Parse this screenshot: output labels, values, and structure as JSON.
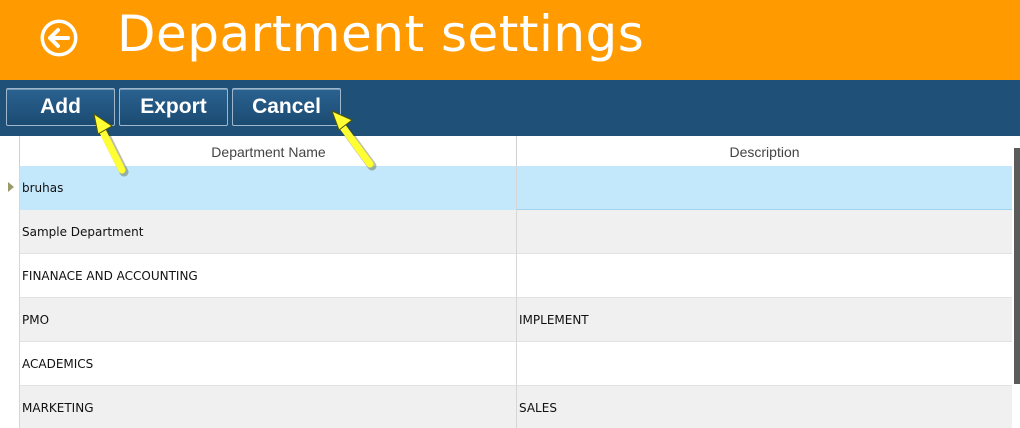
{
  "header": {
    "title": "Department settings",
    "back_icon": "back-arrow-circle-icon",
    "background_color": "#ff9a00"
  },
  "toolbar": {
    "add_label": "Add",
    "export_label": "Export",
    "cancel_label": "Cancel",
    "background_color": "#1f5077"
  },
  "grid": {
    "columns": [
      "Department Name",
      "Description"
    ],
    "rows": [
      {
        "name": "bruhas",
        "description": "",
        "selected": true
      },
      {
        "name": "Sample Department",
        "description": ""
      },
      {
        "name": "FINANACE AND ACCOUNTING",
        "description": ""
      },
      {
        "name": "PMO",
        "description": "IMPLEMENT"
      },
      {
        "name": "ACADEMICS",
        "description": ""
      },
      {
        "name": "MARKETING",
        "description": "SALES"
      }
    ],
    "selection_color": "#c3e7fb"
  },
  "annotations": {
    "arrow_color": "#ffff33",
    "arrows": [
      "pointer-arrow-icon",
      "pointer-arrow-icon"
    ]
  }
}
